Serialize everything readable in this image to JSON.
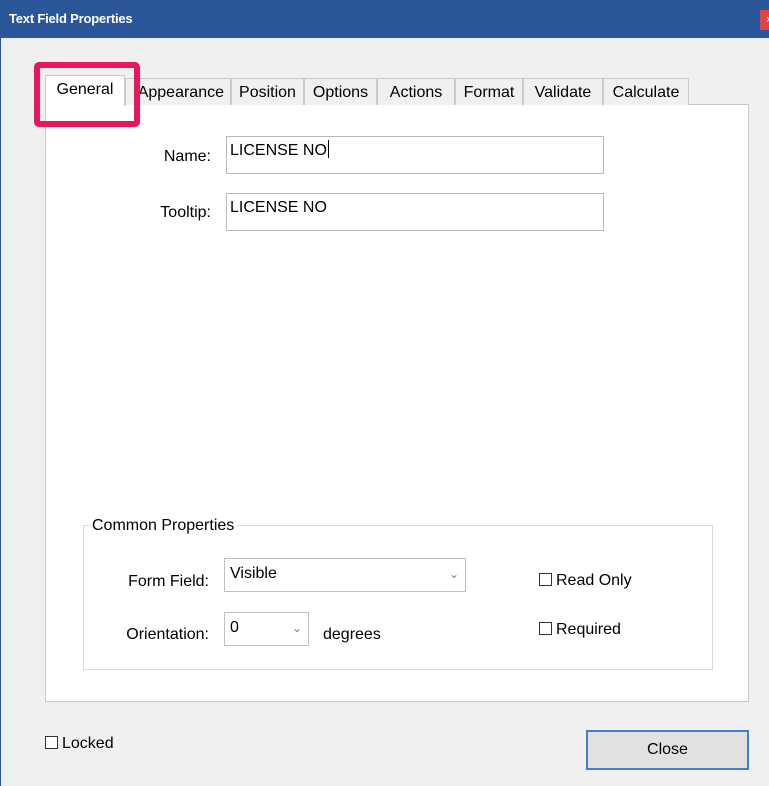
{
  "window": {
    "title": "Text Field Properties",
    "close_glyph": "×"
  },
  "tabs": [
    {
      "label": "General",
      "active": true
    },
    {
      "label": "Appearance",
      "active": false
    },
    {
      "label": "Position",
      "active": false
    },
    {
      "label": "Options",
      "active": false
    },
    {
      "label": "Actions",
      "active": false
    },
    {
      "label": "Format",
      "active": false
    },
    {
      "label": "Validate",
      "active": false
    },
    {
      "label": "Calculate",
      "active": false
    }
  ],
  "general": {
    "name_label": "Name:",
    "name_value": "LICENSE NO",
    "tooltip_label": "Tooltip:",
    "tooltip_value": "LICENSE NO"
  },
  "common_properties": {
    "title": "Common Properties",
    "form_field_label": "Form Field:",
    "form_field_value": "Visible",
    "orientation_label": "Orientation:",
    "orientation_value": "0",
    "degrees_label": "degrees",
    "read_only_label": "Read Only",
    "read_only_checked": false,
    "required_label": "Required",
    "required_checked": false
  },
  "footer": {
    "locked_label": "Locked",
    "locked_checked": false,
    "close_button_label": "Close"
  },
  "colors": {
    "titlebar": "#2b579a",
    "highlight": "#e8175d",
    "button_focus": "#3a7fd5"
  },
  "icons": {
    "dropdown_arrow": "chevron-down-icon"
  }
}
